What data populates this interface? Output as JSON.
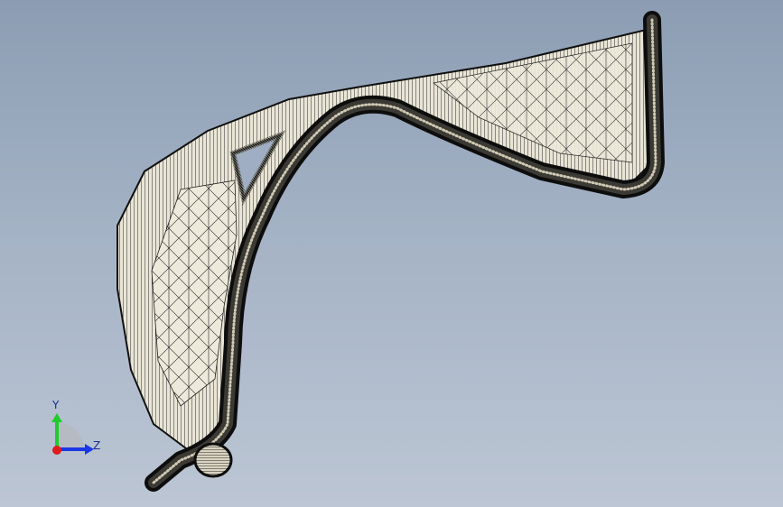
{
  "viewport": {
    "background_top": "#8c9db3",
    "background_bottom": "#bcc6d4",
    "render_mode": "wireframe-mesh",
    "model_fill": "#e9e5d6",
    "mesh_line_color": "#111111"
  },
  "triad": {
    "y_label": "Y",
    "z_label": "Z",
    "y_color": "#1fcc2a",
    "z_color": "#1b36e6",
    "x_color": "#e01b1b"
  }
}
